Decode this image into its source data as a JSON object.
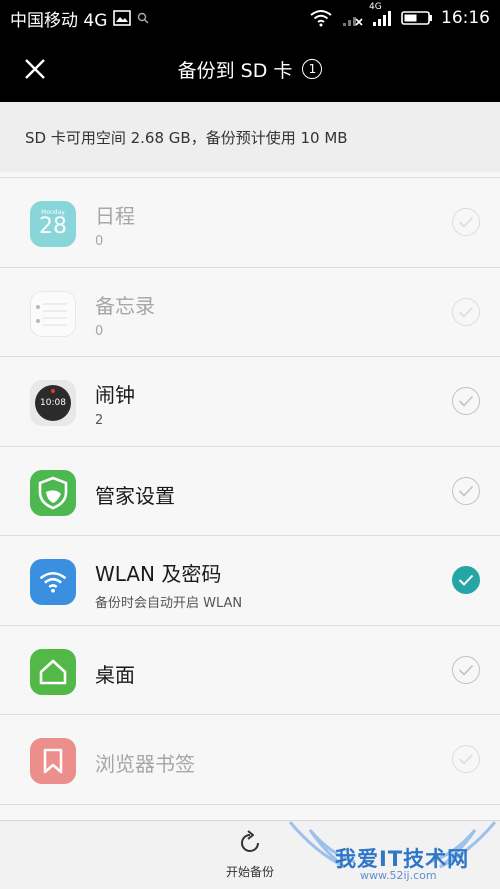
{
  "status": {
    "carrier": "中国移动 4G",
    "network_badge": "4G",
    "time": "16:16",
    "icons": [
      "image-icon",
      "search-icon",
      "wifi-icon",
      "no-signal-icon",
      "signal-icon",
      "battery-icon"
    ]
  },
  "header": {
    "title": "备份到 SD 卡",
    "badge": "1",
    "close_icon": "close-icon"
  },
  "info": {
    "text": "SD 卡可用空间 2.68 GB，备份预计使用 10 MB"
  },
  "items": [
    {
      "title": "日程",
      "sub": "0",
      "icon": "calendar-icon",
      "icon_label": "Monday",
      "icon_number": "28",
      "checked": false,
      "disabled": true
    },
    {
      "title": "备忘录",
      "sub": "0",
      "icon": "notepad-icon",
      "checked": false,
      "disabled": true
    },
    {
      "title": "闹钟",
      "sub": "2",
      "icon": "clock-icon",
      "icon_time": "10:08",
      "checked": false,
      "disabled": false
    },
    {
      "title": "管家设置",
      "sub": "",
      "icon": "shield-icon",
      "checked": false,
      "disabled": false
    },
    {
      "title": "WLAN 及密码",
      "sub": "备份时会自动开启 WLAN",
      "icon": "wifi-icon",
      "checked": true,
      "disabled": false
    },
    {
      "title": "桌面",
      "sub": "",
      "icon": "home-icon",
      "checked": false,
      "disabled": false
    },
    {
      "title": "浏览器书签",
      "sub": "",
      "icon": "bookmark-icon",
      "checked": false,
      "disabled": true
    }
  ],
  "footer": {
    "start_label": "开始备份",
    "start_icon": "refresh-icon"
  },
  "watermark": {
    "text": "我爱IT技术网",
    "url": "www.52ij.com"
  },
  "colors": {
    "accent": "#26a5a5",
    "calendar": "#2fbcc4",
    "shield": "#4cb84f",
    "wifi": "#3a8fe0",
    "home": "#52b848",
    "bookmark": "#e23a35"
  }
}
